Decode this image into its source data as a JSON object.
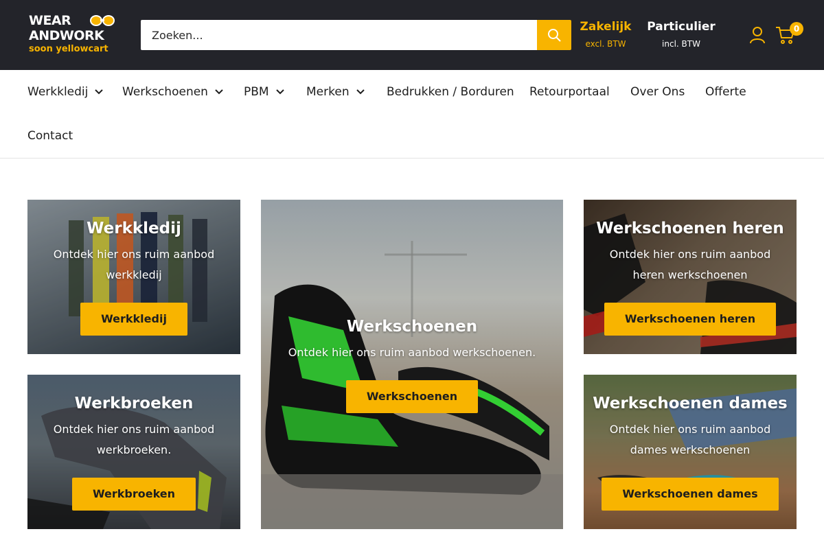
{
  "header": {
    "logo": {
      "line1": "WEAR",
      "line2": "ANDWORK",
      "line3": "soon yellowcart"
    },
    "search": {
      "placeholder": "Zoeken..."
    },
    "price_toggle": [
      {
        "label": "Zakelijk",
        "sub": "excl. BTW"
      },
      {
        "label": "Particulier",
        "sub": "incl. BTW"
      }
    ],
    "cart_count": "0",
    "icons": {
      "search": "search-icon",
      "account": "user-icon",
      "cart": "cart-icon"
    }
  },
  "nav": {
    "items": [
      {
        "label": "Werkkledij",
        "dropdown": true
      },
      {
        "label": "Werkschoenen",
        "dropdown": true
      },
      {
        "label": "PBM",
        "dropdown": true
      },
      {
        "label": "Merken",
        "dropdown": true
      },
      {
        "label": "Bedrukken / Borduren",
        "dropdown": false
      },
      {
        "label": "Retourportaal",
        "dropdown": false
      },
      {
        "label": "Over Ons",
        "dropdown": false
      },
      {
        "label": "Offerte",
        "dropdown": false
      },
      {
        "label": "Contact",
        "dropdown": false
      }
    ]
  },
  "tiles": [
    {
      "title": "Werkkledij",
      "description": "Ontdek hier ons ruim aanbod werkkledij",
      "button": "Werkkledij"
    },
    {
      "title": "Werkschoenen",
      "description": "Ontdek hier ons ruim aanbod werkschoenen.",
      "button": "Werkschoenen"
    },
    {
      "title": "Werkschoenen heren",
      "description": "Ontdek hier ons ruim aanbod heren werkschoenen",
      "button": "Werkschoenen heren"
    },
    {
      "title": "Werkbroeken",
      "description": "Ontdek hier ons ruim aanbod werkbroeken.",
      "button": "Werkbroeken"
    },
    {
      "title": "Werkschoenen dames",
      "description": "Ontdek hier ons ruim aanbod dames werkschoenen",
      "button": "Werkschoenen dames"
    }
  ],
  "colors": {
    "header_bg": "#23242a",
    "accent": "#f8b400",
    "text": "#1e1e1e"
  }
}
